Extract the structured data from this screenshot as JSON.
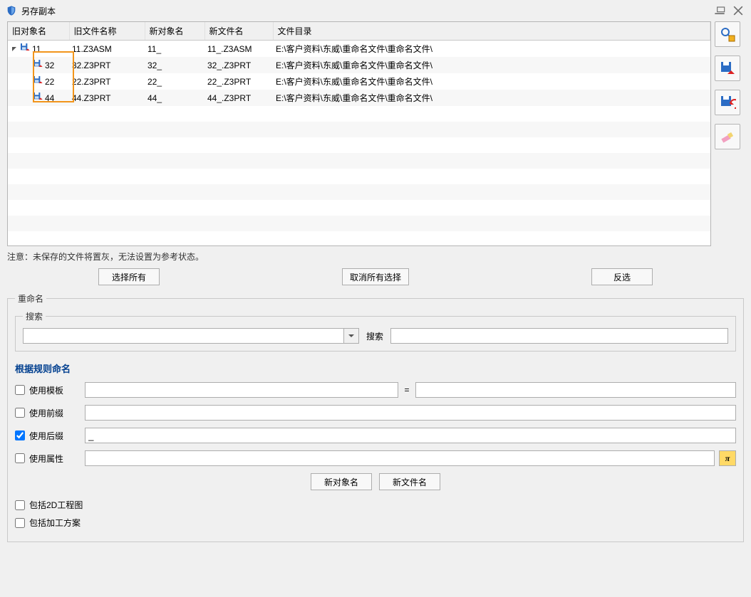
{
  "window": {
    "title": "另存副本"
  },
  "table": {
    "headers": {
      "old_obj": "旧对象名",
      "old_file": "旧文件名称",
      "new_obj": "新对象名",
      "new_file": "新文件名",
      "dir": "文件目录"
    },
    "rows": [
      {
        "indent": 0,
        "expandable": true,
        "expanded": true,
        "old_obj": "11",
        "old_file": "11.Z3ASM",
        "new_obj": "11_",
        "new_file": "11_.Z3ASM",
        "dir": "E:\\客户资料\\东威\\重命名文件\\重命名文件\\"
      },
      {
        "indent": 1,
        "expandable": false,
        "old_obj": "32",
        "old_file": "32.Z3PRT",
        "new_obj": "32_",
        "new_file": "32_.Z3PRT",
        "dir": "E:\\客户资料\\东威\\重命名文件\\重命名文件\\"
      },
      {
        "indent": 1,
        "expandable": false,
        "old_obj": "22",
        "old_file": "22.Z3PRT",
        "new_obj": "22_",
        "new_file": "22_.Z3PRT",
        "dir": "E:\\客户资料\\东威\\重命名文件\\重命名文件\\"
      },
      {
        "indent": 1,
        "expandable": false,
        "old_obj": "44",
        "old_file": "44.Z3PRT",
        "new_obj": "44_",
        "new_file": "44_.Z3PRT",
        "dir": "E:\\客户资料\\东威\\重命名文件\\重命名文件\\"
      }
    ]
  },
  "note": "注意：未保存的文件将置灰，无法设置为参考状态。",
  "buttons": {
    "select_all": "选择所有",
    "deselect_all": "取消所有选择",
    "invert": "反选",
    "new_obj_name": "新对象名",
    "new_file_name": "新文件名"
  },
  "rename": {
    "legend": "重命名",
    "search_legend": "搜索",
    "search_combo_value": "",
    "search_label": "搜索",
    "search_value": "",
    "rule_title": "根据规则命名",
    "use_template_label": "使用模板",
    "use_template_checked": false,
    "template_value": "",
    "template_eq": "=",
    "template_value2": "",
    "use_prefix_label": "使用前缀",
    "use_prefix_checked": false,
    "prefix_value": "",
    "use_suffix_label": "使用后缀",
    "use_suffix_checked": true,
    "suffix_value": "_",
    "use_attr_label": "使用属性",
    "use_attr_checked": false,
    "attr_value": "",
    "include_2d_label": "包括2D工程图",
    "include_2d_checked": false,
    "include_cam_label": "包括加工方案",
    "include_cam_checked": false
  }
}
